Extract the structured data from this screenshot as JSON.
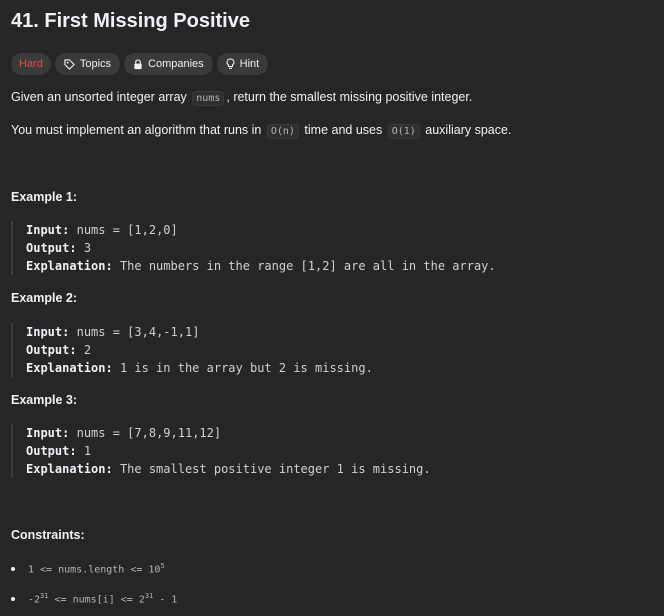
{
  "problem": {
    "title": "41. First Missing Positive"
  },
  "tags": {
    "difficulty": "Hard",
    "topics": "Topics",
    "companies": "Companies",
    "hint": "Hint"
  },
  "description": {
    "p1_before": "Given an unsorted integer array ",
    "p1_code": "nums",
    "p1_after": ", return the smallest missing positive integer.",
    "p2_before": "You must implement an algorithm that runs in ",
    "p2_code1": "O(n)",
    "p2_mid": " time and uses ",
    "p2_code2": "O(1)",
    "p2_after": " auxiliary space."
  },
  "examples": [
    {
      "heading": "Example 1:",
      "input_label": "Input:",
      "input": "nums = [1,2,0]",
      "output_label": "Output:",
      "output": "3",
      "explanation_label": "Explanation:",
      "explanation": "The numbers in the range [1,2] are all in the array."
    },
    {
      "heading": "Example 2:",
      "input_label": "Input:",
      "input": "nums = [3,4,-1,1]",
      "output_label": "Output:",
      "output": "2",
      "explanation_label": "Explanation:",
      "explanation": "1 is in the array but 2 is missing."
    },
    {
      "heading": "Example 3:",
      "input_label": "Input:",
      "input": "nums = [7,8,9,11,12]",
      "output_label": "Output:",
      "output": "1",
      "explanation_label": "Explanation:",
      "explanation": "The smallest positive integer 1 is missing."
    }
  ],
  "constraints": {
    "heading": "Constraints:",
    "c1_prefix": "1 <= nums.length <= 10",
    "c1_exp": "5",
    "c2_prefix": "-2",
    "c2_exp1": "31",
    "c2_mid": " <= nums[i] <= 2",
    "c2_exp2": "31",
    "c2_suffix": " - 1"
  },
  "colors": {
    "background": "#262626",
    "text": "#eff1f6",
    "hard": "#ef4743",
    "tag_bg": "#3a3a3a"
  }
}
